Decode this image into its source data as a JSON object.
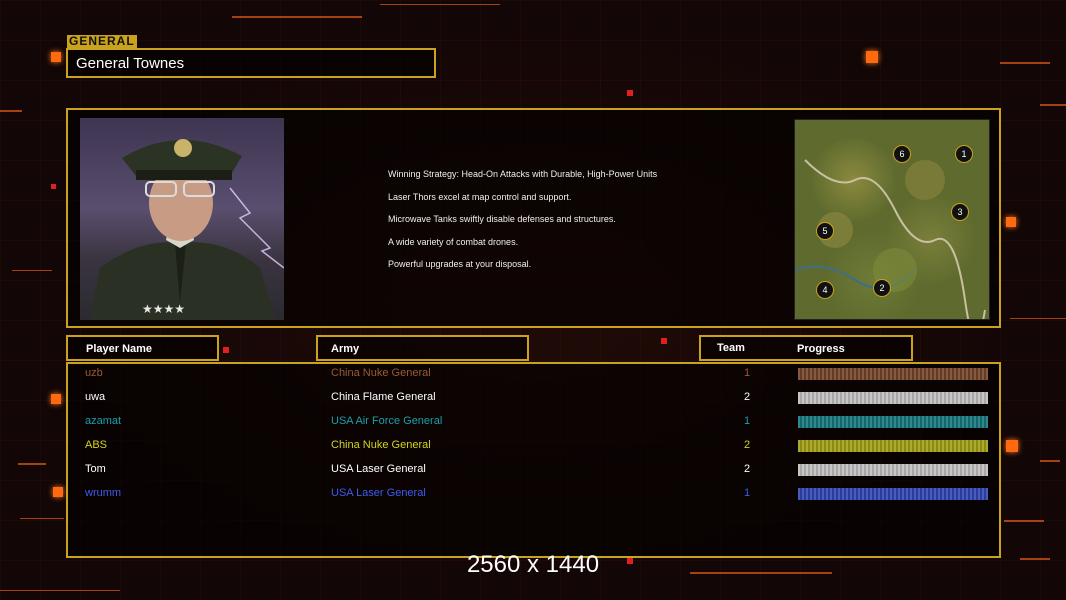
{
  "header": {
    "section_tag": "GENERAL",
    "general_name": "General Townes"
  },
  "description": {
    "lines": [
      "Winning Strategy: Head-On Attacks with Durable, High-Power Units",
      "Laser Thors excel at map control and support.",
      "Microwave Tanks swiftly disable defenses and structures.",
      "A wide variety of combat drones.",
      "Powerful upgrades at your disposal."
    ]
  },
  "minimap": {
    "start_positions": [
      "6",
      "1",
      "3",
      "5",
      "4",
      "2"
    ]
  },
  "table": {
    "headers": {
      "player_name": "Player Name",
      "army": "Army",
      "team": "Team",
      "progress": "Progress"
    },
    "rows": [
      {
        "player": "uzb",
        "army": "China Nuke General",
        "team": "1",
        "color": "#9a5a36",
        "progress": 1.0
      },
      {
        "player": "uwa",
        "army": "China Flame General",
        "team": "2",
        "color": "#ffffff",
        "progress": 1.0
      },
      {
        "player": "azamat",
        "army": "USA Air Force General",
        "team": "1",
        "color": "#1aa0a8",
        "progress": 1.0
      },
      {
        "player": "ABS",
        "army": "China Nuke General",
        "team": "2",
        "color": "#d4d41a",
        "progress": 1.0
      },
      {
        "player": "Tom",
        "army": "USA Laser General",
        "team": "2",
        "color": "#ffffff",
        "progress": 1.0
      },
      {
        "player": "wrumm",
        "army": "USA Laser General",
        "team": "1",
        "color": "#3d5cf0",
        "progress": 1.0
      }
    ]
  },
  "footer": {
    "resolution": "2560 x 1440"
  },
  "colors": {
    "frame": "#c9a21e",
    "accent": "#ff6a10"
  }
}
